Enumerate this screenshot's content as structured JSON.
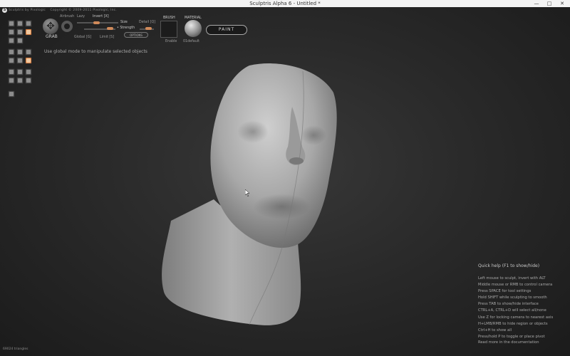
{
  "window": {
    "title": "Sculptris Alpha 6 - Untitled *",
    "minimize": "—",
    "maximize": "□",
    "close": "✕"
  },
  "credits": {
    "left": "Sculptris by Pixologic",
    "right": "Copyright © 2009-2011 Pixologic, Inc."
  },
  "tool_panel": {
    "active_tool": "grab",
    "icons": [
      "draw-icon",
      "crease-icon",
      "grab-icon",
      "flatten-icon",
      "inflate-icon",
      "pinch-icon",
      "rotate-icon",
      "scale-icon",
      "move-icon",
      "mask-icon",
      "reduce-icon",
      "smooth-icon",
      "symmetry-icon",
      "wireframe-icon",
      "image-icon"
    ]
  },
  "grab": {
    "label": "GRAB",
    "airbrush": "Airbrush",
    "lazy": "Lazy",
    "invert": "Invert [X]",
    "size": "Size",
    "detail": "Detail [Q]",
    "strength": "Strength",
    "global": "Global [G]",
    "limit": "Limit [S]",
    "options": "OPTIONS"
  },
  "brush": {
    "label": "BRUSH",
    "enable": "Enable"
  },
  "material": {
    "label": "MATERIAL",
    "name": "01default"
  },
  "paint_button": "PAINT",
  "hint": "Use global mode to manipulate selected objects",
  "quick_help": {
    "title": "Quick help (F1 to show/hide)",
    "lines": [
      "Left mouse to sculpt, invert with ALT",
      "Middle mouse or RMB to control camera",
      "Press SPACE for tool settings",
      "Hold SHIFT while sculpting to smooth",
      "Press TAB to show/hide interface",
      "CTRL+A, CTRL+D will select all/none",
      "Use Z for locking camera to nearest axis",
      "H+LMB/RMB to hide region or objects",
      "Ctrl+H to show all",
      "Press/hold P to toggle or place pivot"
    ],
    "more": "Read more in the documentation"
  },
  "status": {
    "triangles": "69024 triangles"
  },
  "colors": {
    "accent": "#d87a3a",
    "viewport": "#2a2a2a"
  }
}
